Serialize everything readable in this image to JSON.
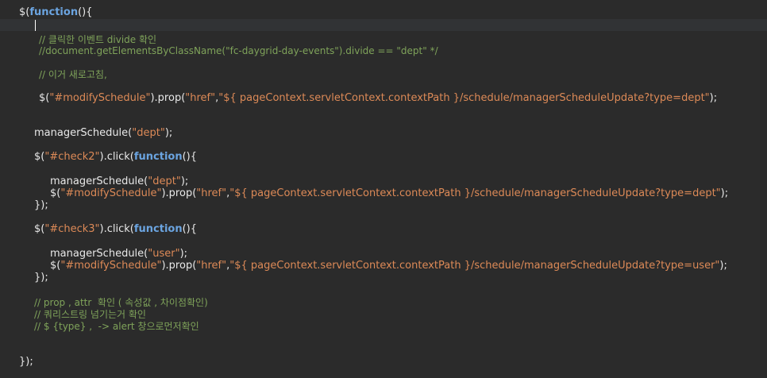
{
  "editor": {
    "lines": {
      "l0": [
        {
          "t": "$(",
          "c": "plain"
        },
        {
          "t": "function",
          "c": "kw"
        },
        {
          "t": "(){",
          "c": "plain"
        }
      ],
      "l2": [
        {
          "t": "// 클릭한 이벤트 divide 확인",
          "c": "cm"
        }
      ],
      "l3": [
        {
          "t": "//document.getElementsByClassName(\"fc-daygrid-day-events\").divide == \"dept\" */",
          "c": "cm"
        }
      ],
      "l5": [
        {
          "t": "// 이거 새로고침,",
          "c": "cm"
        }
      ],
      "l7": [
        {
          "t": "$(",
          "c": "plain"
        },
        {
          "t": "\"#modifySchedule\"",
          "c": "str"
        },
        {
          "t": ").prop(",
          "c": "plain"
        },
        {
          "t": "\"href\"",
          "c": "str"
        },
        {
          "t": ",",
          "c": "plain"
        },
        {
          "t": "\"${ pageContext.servletContext.contextPath }/schedule/managerScheduleUpdate?type=dept\"",
          "c": "str"
        },
        {
          "t": ");",
          "c": "plain"
        }
      ],
      "l10": [
        {
          "t": "managerSchedule(",
          "c": "plain"
        },
        {
          "t": "\"dept\"",
          "c": "str"
        },
        {
          "t": ");",
          "c": "plain"
        }
      ],
      "l12": [
        {
          "t": "$(",
          "c": "plain"
        },
        {
          "t": "\"#check2\"",
          "c": "str"
        },
        {
          "t": ").click(",
          "c": "plain"
        },
        {
          "t": "function",
          "c": "kw"
        },
        {
          "t": "(){",
          "c": "plain"
        }
      ],
      "l14": [
        {
          "t": "managerSchedule(",
          "c": "plain"
        },
        {
          "t": "\"dept\"",
          "c": "str"
        },
        {
          "t": ");",
          "c": "plain"
        }
      ],
      "l15": [
        {
          "t": "$(",
          "c": "plain"
        },
        {
          "t": "\"#modifySchedule\"",
          "c": "str"
        },
        {
          "t": ").prop(",
          "c": "plain"
        },
        {
          "t": "\"href\"",
          "c": "str"
        },
        {
          "t": ",",
          "c": "plain"
        },
        {
          "t": "\"${ pageContext.servletContext.contextPath }/schedule/managerScheduleUpdate?type=dept\"",
          "c": "str"
        },
        {
          "t": ");",
          "c": "plain"
        }
      ],
      "l16": [
        {
          "t": "});",
          "c": "plain"
        }
      ],
      "l18": [
        {
          "t": "$(",
          "c": "plain"
        },
        {
          "t": "\"#check3\"",
          "c": "str"
        },
        {
          "t": ").click(",
          "c": "plain"
        },
        {
          "t": "function",
          "c": "kw"
        },
        {
          "t": "(){",
          "c": "plain"
        }
      ],
      "l20": [
        {
          "t": "managerSchedule(",
          "c": "plain"
        },
        {
          "t": "\"user\"",
          "c": "str"
        },
        {
          "t": ");",
          "c": "plain"
        }
      ],
      "l21": [
        {
          "t": "$(",
          "c": "plain"
        },
        {
          "t": "\"#modifySchedule\"",
          "c": "str"
        },
        {
          "t": ").prop(",
          "c": "plain"
        },
        {
          "t": "\"href\"",
          "c": "str"
        },
        {
          "t": ",",
          "c": "plain"
        },
        {
          "t": "\"${ pageContext.servletContext.contextPath }/schedule/managerScheduleUpdate?type=user\"",
          "c": "str"
        },
        {
          "t": ");",
          "c": "plain"
        }
      ],
      "l22": [
        {
          "t": "});",
          "c": "plain"
        }
      ],
      "l24": [
        {
          "t": "// prop , attr  확인 ( 속성값 , 차이점확인)",
          "c": "cm"
        }
      ],
      "l25": [
        {
          "t": "// 쿼리스트링 넘기는거 확인",
          "c": "cm"
        }
      ],
      "l26": [
        {
          "t": "// $ {type} ,  -> alert 창으로먼저확인",
          "c": "cm"
        }
      ],
      "l29": [
        {
          "t": "});",
          "c": "plain"
        }
      ]
    }
  }
}
